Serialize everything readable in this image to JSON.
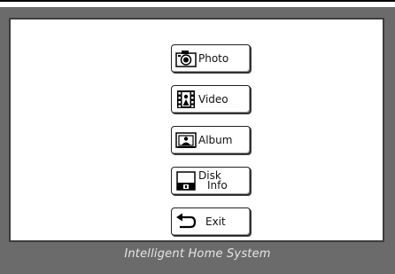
{
  "menu": {
    "items": [
      {
        "label": "Photo",
        "icon": "camera-icon"
      },
      {
        "label": "Video",
        "icon": "film-icon"
      },
      {
        "label": "Album",
        "icon": "album-icon"
      },
      {
        "label_line1": "Disk",
        "label_line2": "Info",
        "icon": "floppy-disk-icon"
      },
      {
        "label": "Exit",
        "icon": "back-arrow-icon"
      }
    ]
  },
  "footer": {
    "title": "Intelligent Home System"
  },
  "colors": {
    "frame": "#6b6b6b",
    "panel": "#ffffff",
    "footer_text": "#e6e6e6"
  }
}
